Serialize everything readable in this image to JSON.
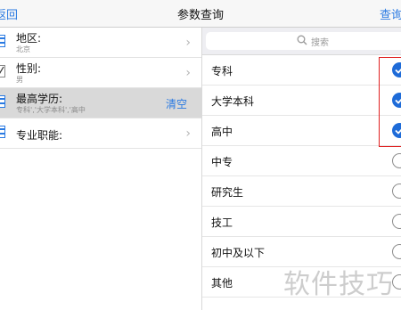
{
  "nav": {
    "back_label": "返回",
    "title": "参数查询",
    "action_label": "查询"
  },
  "filters": [
    {
      "title": "地区:",
      "value": "北京"
    },
    {
      "title": "性别:",
      "value": "男"
    },
    {
      "title": "最高学历:",
      "value": "专科','大学本科','高中",
      "action": "清空"
    },
    {
      "title": "专业职能:",
      "value": ""
    }
  ],
  "search": {
    "placeholder": "搜索"
  },
  "options": [
    {
      "label": "专科",
      "checked": true
    },
    {
      "label": "大学本科",
      "checked": true
    },
    {
      "label": "高中",
      "checked": true
    },
    {
      "label": "中专",
      "checked": false
    },
    {
      "label": "研究生",
      "checked": false
    },
    {
      "label": "技工",
      "checked": false
    },
    {
      "label": "初中及以下",
      "checked": false
    },
    {
      "label": "其他",
      "checked": false
    }
  ],
  "watermark": "软件技巧",
  "colors": {
    "accent": "#2a7ae2",
    "check_fill": "#1e6bd8",
    "highlight": "#e02020"
  }
}
